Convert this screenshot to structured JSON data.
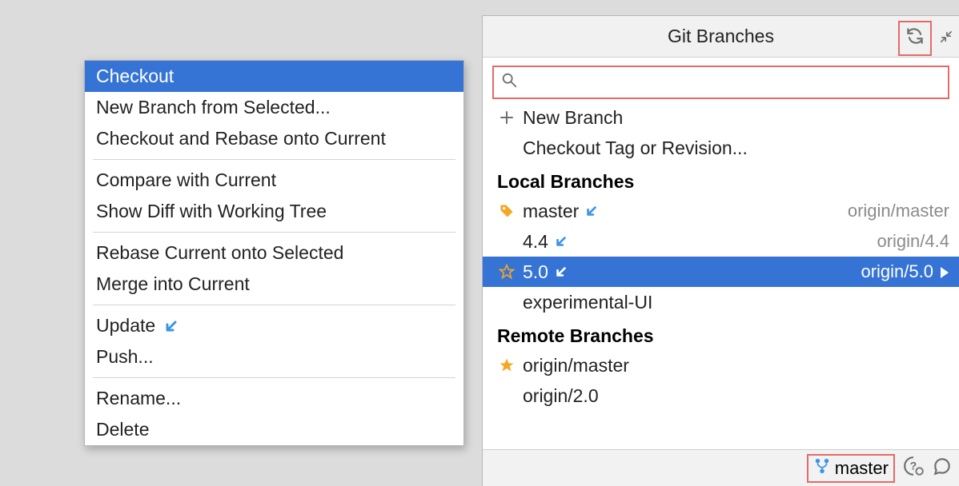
{
  "context_menu": {
    "items": [
      "Checkout",
      "New Branch from Selected...",
      "Checkout and Rebase onto Current",
      "Compare with Current",
      "Show Diff with Working Tree",
      "Rebase Current onto Selected",
      "Merge into Current",
      "Update",
      "Push...",
      "Rename...",
      "Delete"
    ]
  },
  "branches_popup": {
    "title": "Git Branches",
    "search_placeholder": "",
    "actions": {
      "new_branch": "New Branch",
      "checkout_tag": "Checkout Tag or Revision..."
    },
    "local_header": "Local Branches",
    "local_branches": [
      {
        "name": "master",
        "remote": "origin/master"
      },
      {
        "name": "4.4",
        "remote": "origin/4.4"
      },
      {
        "name": "5.0",
        "remote": "origin/5.0"
      },
      {
        "name": "experimental-UI",
        "remote": ""
      }
    ],
    "remote_header": "Remote Branches",
    "remote_branches": [
      {
        "name": "origin/master"
      },
      {
        "name": "origin/2.0"
      }
    ]
  },
  "status_bar": {
    "branch": "master"
  }
}
